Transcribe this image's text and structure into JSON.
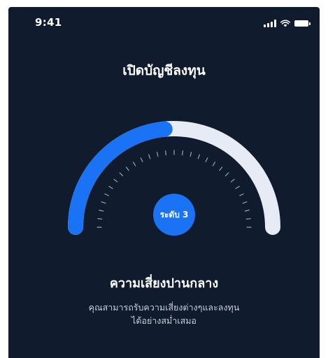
{
  "status_bar": {
    "time": "9:41"
  },
  "header": {
    "title": "เปิดบัญชีลงทุน"
  },
  "gauge": {
    "level_label": "ระดับ 3",
    "fill_fraction": 0.47,
    "track_color": "#e6ebf5",
    "fill_color": "#1a73f5",
    "badge_color": "#1a73f5"
  },
  "risk": {
    "title": "ความเสี่ยงปานกลาง",
    "description_line1": "คุณสามารถรับความเสี่ยงต่างๆและลงทุน",
    "description_line2": "ได้อย่างสม่ำเสมอ"
  }
}
